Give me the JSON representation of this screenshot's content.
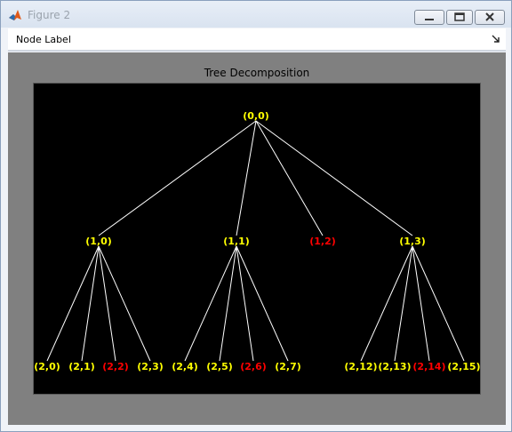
{
  "window": {
    "title": "Figure 2"
  },
  "menu": {
    "items": [
      "Node Label"
    ]
  },
  "plot": {
    "title": "Tree Decomposition",
    "colors": {
      "normal": "#ffff00",
      "terminal": "#ff0000",
      "edge": "#ffffff",
      "background": "#000000"
    }
  },
  "tree": {
    "nodes": [
      {
        "id": "(0,0)",
        "parent": null,
        "status": "normal"
      },
      {
        "id": "(1,0)",
        "parent": "(0,0)",
        "status": "normal"
      },
      {
        "id": "(1,1)",
        "parent": "(0,0)",
        "status": "normal"
      },
      {
        "id": "(1,2)",
        "parent": "(0,0)",
        "status": "terminal"
      },
      {
        "id": "(1,3)",
        "parent": "(0,0)",
        "status": "normal"
      },
      {
        "id": "(2,0)",
        "parent": "(1,0)",
        "status": "normal"
      },
      {
        "id": "(2,1)",
        "parent": "(1,0)",
        "status": "normal"
      },
      {
        "id": "(2,2)",
        "parent": "(1,0)",
        "status": "terminal"
      },
      {
        "id": "(2,3)",
        "parent": "(1,0)",
        "status": "normal"
      },
      {
        "id": "(2,4)",
        "parent": "(1,1)",
        "status": "normal"
      },
      {
        "id": "(2,5)",
        "parent": "(1,1)",
        "status": "normal"
      },
      {
        "id": "(2,6)",
        "parent": "(1,1)",
        "status": "terminal"
      },
      {
        "id": "(2,7)",
        "parent": "(1,1)",
        "status": "normal"
      },
      {
        "id": "(2,12)",
        "parent": "(1,3)",
        "status": "normal"
      },
      {
        "id": "(2,13)",
        "parent": "(1,3)",
        "status": "normal"
      },
      {
        "id": "(2,14)",
        "parent": "(1,3)",
        "status": "terminal"
      },
      {
        "id": "(2,15)",
        "parent": "(1,3)",
        "status": "normal"
      }
    ]
  }
}
